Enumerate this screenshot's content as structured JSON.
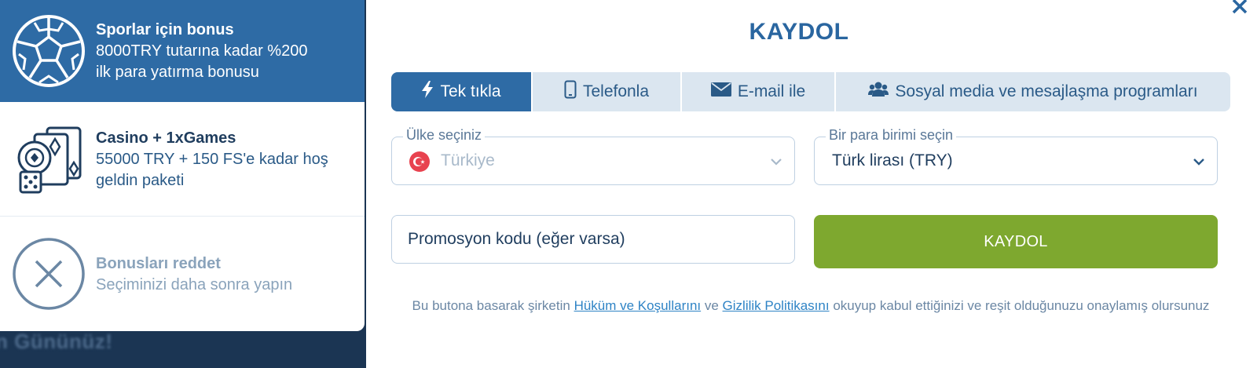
{
  "background": {
    "text": "n Gününüz!"
  },
  "bonuses": [
    {
      "title": "Sporlar için bonus",
      "desc_line1": "8000TRY tutarına kadar %200",
      "desc_line2": "ilk para yatırma bonusu",
      "icon": "soccer-ball-icon"
    },
    {
      "title": "Casino + 1xGames",
      "desc_line1": "55000 TRY + 150 FS'e kadar hoş",
      "desc_line2": "geldin paketi",
      "icon": "casino-cards-icon"
    },
    {
      "title": "Bonusları reddet",
      "desc_line1": "Seçiminizi daha sonra yapın",
      "icon": "decline-icon"
    }
  ],
  "modal": {
    "title": "KAYDOL",
    "tabs": [
      {
        "label": "Tek tıkla",
        "icon": "lightning-icon",
        "active": true
      },
      {
        "label": "Telefonla",
        "icon": "phone-icon",
        "active": false
      },
      {
        "label": "E-mail ile",
        "icon": "envelope-icon",
        "active": false
      },
      {
        "label": "Sosyal media ve mesajlaşma programları",
        "icon": "users-icon",
        "active": false
      }
    ],
    "country": {
      "label": "Ülke seçiniz",
      "value": "Türkiye"
    },
    "currency": {
      "label": "Bir para birimi seçin",
      "value": "Türk lirası (TRY)"
    },
    "promo": {
      "placeholder": "Promosyon kodu (eğer varsa)"
    },
    "submit_label": "KAYDOL",
    "legal": {
      "before": "Bu butona basarak şirketin ",
      "terms_link": "Hüküm ve Koşullarını",
      "middle": " ve ",
      "privacy_link": "Gizlilik Politikasını",
      "after": " okuyup kabul ettiğinizi ve reşit olduğunuzu onaylamış olursunuz"
    }
  },
  "colors": {
    "primary": "#2e6ba5",
    "submit": "#7ea82f",
    "tab_bg": "#dbe6f0"
  }
}
